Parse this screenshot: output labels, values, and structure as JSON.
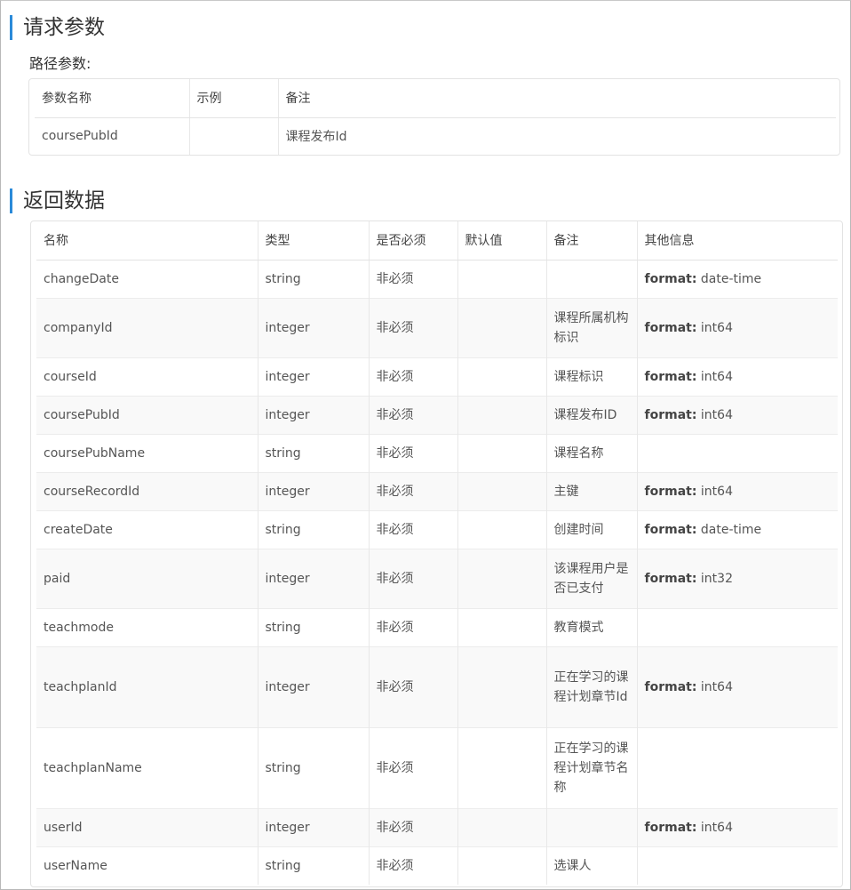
{
  "request_section": {
    "title": "请求参数",
    "path_label": "路径参数:",
    "headers": [
      "参数名称",
      "示例",
      "备注"
    ],
    "rows": [
      {
        "name": "coursePubId",
        "example": "",
        "note": "课程发布Id"
      }
    ]
  },
  "response_section": {
    "title": "返回数据",
    "headers": [
      "名称",
      "类型",
      "是否必须",
      "默认值",
      "备注",
      "其他信息"
    ],
    "rows": [
      {
        "name": "changeDate",
        "type": "string",
        "required": "非必须",
        "default": "",
        "note": "",
        "info_key": "format:",
        "info_val": "date-time"
      },
      {
        "name": "companyId",
        "type": "integer",
        "required": "非必须",
        "default": "",
        "note": "课程所属机构标识",
        "info_key": "format:",
        "info_val": "int64"
      },
      {
        "name": "courseId",
        "type": "integer",
        "required": "非必须",
        "default": "",
        "note": "课程标识",
        "info_key": "format:",
        "info_val": "int64"
      },
      {
        "name": "coursePubId",
        "type": "integer",
        "required": "非必须",
        "default": "",
        "note": "课程发布ID",
        "info_key": "format:",
        "info_val": "int64"
      },
      {
        "name": "coursePubName",
        "type": "string",
        "required": "非必须",
        "default": "",
        "note": "课程名称",
        "info_key": "",
        "info_val": ""
      },
      {
        "name": "courseRecordId",
        "type": "integer",
        "required": "非必须",
        "default": "",
        "note": "主键",
        "info_key": "format:",
        "info_val": "int64"
      },
      {
        "name": "createDate",
        "type": "string",
        "required": "非必须",
        "default": "",
        "note": "创建时间",
        "info_key": "format:",
        "info_val": "date-time"
      },
      {
        "name": "paid",
        "type": "integer",
        "required": "非必须",
        "default": "",
        "note": "该课程用户是否已支付",
        "info_key": "format:",
        "info_val": "int32"
      },
      {
        "name": "teachmode",
        "type": "string",
        "required": "非必须",
        "default": "",
        "note": "教育模式",
        "info_key": "",
        "info_val": ""
      },
      {
        "name": "teachplanId",
        "type": "integer",
        "required": "非必须",
        "default": "",
        "note": "正在学习的课程计划章节Id",
        "info_key": "format:",
        "info_val": "int64"
      },
      {
        "name": "teachplanName",
        "type": "string",
        "required": "非必须",
        "default": "",
        "note": "正在学习的课程计划章节名称",
        "info_key": "",
        "info_val": ""
      },
      {
        "name": "userId",
        "type": "integer",
        "required": "非必须",
        "default": "",
        "note": "",
        "info_key": "format:",
        "info_val": "int64"
      },
      {
        "name": "userName",
        "type": "string",
        "required": "非必须",
        "default": "",
        "note": "选课人",
        "info_key": "",
        "info_val": ""
      }
    ]
  },
  "colors": {
    "accent": "#2b8ad9",
    "stripe": "#f9f9f9",
    "border": "#e3e3e3"
  }
}
